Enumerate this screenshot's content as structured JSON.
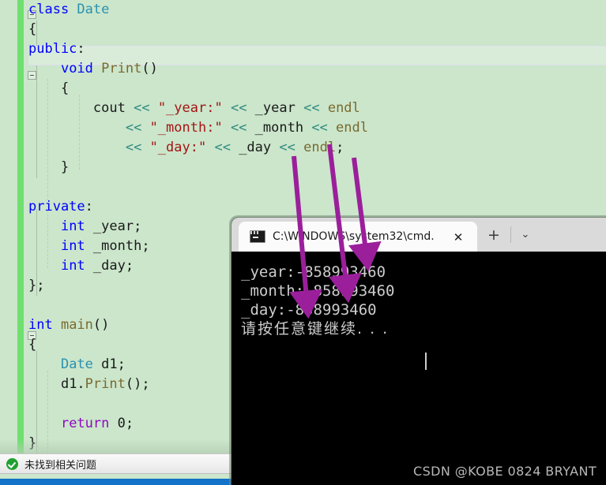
{
  "editor": {
    "language": "cpp",
    "background_color": "#cbe6cb",
    "current_line_color": "#d9ecd9",
    "change_bar_color": "#6fe06f",
    "lines": [
      {
        "indent": 0,
        "fold": true,
        "current": false,
        "tokens": [
          {
            "t": "class ",
            "c": "kw"
          },
          {
            "t": "Date",
            "c": "type"
          }
        ]
      },
      {
        "indent": 0,
        "fold": false,
        "current": false,
        "tokens": [
          {
            "t": "{",
            "c": "pl"
          }
        ]
      },
      {
        "indent": 0,
        "fold": false,
        "current": true,
        "tokens": [
          {
            "t": "public",
            "c": "kw"
          },
          {
            "t": ":",
            "c": "pl"
          }
        ]
      },
      {
        "indent": 1,
        "fold": true,
        "current": false,
        "tokens": [
          {
            "t": "void ",
            "c": "kw"
          },
          {
            "t": "Print",
            "c": "fn"
          },
          {
            "t": "()",
            "c": "pl"
          }
        ]
      },
      {
        "indent": 1,
        "fold": false,
        "current": false,
        "tokens": [
          {
            "t": "{",
            "c": "pl"
          }
        ]
      },
      {
        "indent": 2,
        "fold": false,
        "current": false,
        "tokens": [
          {
            "t": "cout ",
            "c": "pl"
          },
          {
            "t": "<<",
            "c": "op"
          },
          {
            "t": " ",
            "c": "pl"
          },
          {
            "t": "\"_year:\"",
            "c": "str"
          },
          {
            "t": " ",
            "c": "pl"
          },
          {
            "t": "<<",
            "c": "op"
          },
          {
            "t": " _year ",
            "c": "pl"
          },
          {
            "t": "<<",
            "c": "op"
          },
          {
            "t": " ",
            "c": "pl"
          },
          {
            "t": "endl",
            "c": "fn"
          }
        ]
      },
      {
        "indent": 3,
        "fold": false,
        "current": false,
        "tokens": [
          {
            "t": "<<",
            "c": "op"
          },
          {
            "t": " ",
            "c": "pl"
          },
          {
            "t": "\"_month:\"",
            "c": "str"
          },
          {
            "t": " ",
            "c": "pl"
          },
          {
            "t": "<<",
            "c": "op"
          },
          {
            "t": " _month ",
            "c": "pl"
          },
          {
            "t": "<<",
            "c": "op"
          },
          {
            "t": " ",
            "c": "pl"
          },
          {
            "t": "endl",
            "c": "fn"
          }
        ]
      },
      {
        "indent": 3,
        "fold": false,
        "current": false,
        "tokens": [
          {
            "t": "<<",
            "c": "op"
          },
          {
            "t": " ",
            "c": "pl"
          },
          {
            "t": "\"_day:\"",
            "c": "str"
          },
          {
            "t": " ",
            "c": "pl"
          },
          {
            "t": "<<",
            "c": "op"
          },
          {
            "t": " _day ",
            "c": "pl"
          },
          {
            "t": "<<",
            "c": "op"
          },
          {
            "t": " ",
            "c": "pl"
          },
          {
            "t": "endl",
            "c": "fn"
          },
          {
            "t": ";",
            "c": "pl"
          }
        ]
      },
      {
        "indent": 1,
        "fold": false,
        "current": false,
        "tokens": [
          {
            "t": "}",
            "c": "pl"
          }
        ]
      },
      {
        "indent": 0,
        "fold": false,
        "current": false,
        "tokens": []
      },
      {
        "indent": 0,
        "fold": false,
        "current": false,
        "tokens": [
          {
            "t": "private",
            "c": "kw"
          },
          {
            "t": ":",
            "c": "pl"
          }
        ]
      },
      {
        "indent": 1,
        "fold": false,
        "current": false,
        "tokens": [
          {
            "t": "int",
            "c": "kw"
          },
          {
            "t": " _year;",
            "c": "pl"
          }
        ]
      },
      {
        "indent": 1,
        "fold": false,
        "current": false,
        "tokens": [
          {
            "t": "int",
            "c": "kw"
          },
          {
            "t": " _month;",
            "c": "pl"
          }
        ]
      },
      {
        "indent": 1,
        "fold": false,
        "current": false,
        "tokens": [
          {
            "t": "int",
            "c": "kw"
          },
          {
            "t": " _day;",
            "c": "pl"
          }
        ]
      },
      {
        "indent": 0,
        "fold": false,
        "current": false,
        "tokens": [
          {
            "t": "};",
            "c": "pl"
          }
        ]
      },
      {
        "indent": 0,
        "fold": false,
        "current": false,
        "tokens": []
      },
      {
        "indent": 0,
        "fold": true,
        "current": false,
        "tokens": [
          {
            "t": "int ",
            "c": "kw"
          },
          {
            "t": "main",
            "c": "fn"
          },
          {
            "t": "()",
            "c": "pl"
          }
        ]
      },
      {
        "indent": 0,
        "fold": false,
        "current": false,
        "tokens": [
          {
            "t": "{",
            "c": "pl"
          }
        ]
      },
      {
        "indent": 1,
        "fold": false,
        "current": false,
        "tokens": [
          {
            "t": "Date",
            "c": "type"
          },
          {
            "t": " d1;",
            "c": "pl"
          }
        ]
      },
      {
        "indent": 1,
        "fold": false,
        "current": false,
        "tokens": [
          {
            "t": "d1.",
            "c": "pl"
          },
          {
            "t": "Print",
            "c": "fn"
          },
          {
            "t": "();",
            "c": "pl"
          }
        ]
      },
      {
        "indent": 1,
        "fold": false,
        "current": false,
        "tokens": []
      },
      {
        "indent": 1,
        "fold": false,
        "current": false,
        "tokens": [
          {
            "t": "return",
            "c": "ctl"
          },
          {
            "t": " 0;",
            "c": "pl"
          }
        ]
      },
      {
        "indent": 0,
        "fold": false,
        "current": false,
        "tokens": [
          {
            "t": "}",
            "c": "pl"
          }
        ]
      }
    ]
  },
  "statusbar": {
    "icon": "success-check-icon",
    "text": "未找到相关问题",
    "accent_color": "#1fa12f",
    "bottom_bar_color": "#1273c8"
  },
  "console": {
    "tab": {
      "icon": "terminal-icon",
      "title": "C:\\WINDOWS\\system32\\cmd.",
      "close_label": "✕"
    },
    "new_tab_label": "+",
    "menu_label": "⌄",
    "output_lines": [
      "_year:-858993460",
      "_month:-858993460",
      "_day:-858993460"
    ],
    "prompt_line": "请按任意键继续. . .",
    "background_color": "#000000",
    "text_color": "#cccccc"
  },
  "watermark": {
    "text": "CSDN @KOBE 0824 BRYANT"
  },
  "annotations": {
    "arrow_color": "#9b1f9b",
    "arrows": [
      {
        "label": "arrow-year-to-output",
        "from_token": "_year",
        "to_line": "_day:-858993460"
      },
      {
        "label": "arrow-month-to-output",
        "from_token": "_month",
        "to_line": "_month:-858993460"
      },
      {
        "label": "arrow-day-to-output",
        "from_token": "_day",
        "to_line": "_year:-858993460"
      }
    ]
  }
}
